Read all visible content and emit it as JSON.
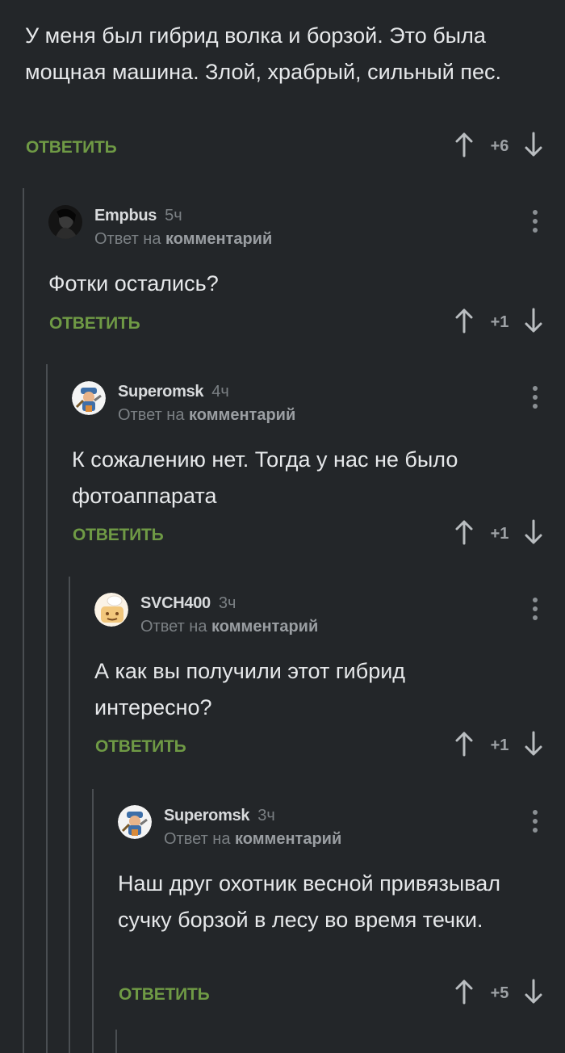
{
  "root": {
    "text": "У меня был гибрид волка и борзой. Это была мощная машина. Злой, храбрый, сильный пес.",
    "reply_label": "ОТВЕТИТЬ",
    "score": "+6"
  },
  "comments": [
    {
      "user": "Empbus",
      "time": "5ч",
      "reply_prefix": "Ответ на",
      "reply_target": "комментарий",
      "text": "Фотки остались?",
      "reply_label": "ОТВЕТИТЬ",
      "score": "+1",
      "avatar": "dark-portrait"
    },
    {
      "user": "Superomsk",
      "time": "4ч",
      "reply_prefix": "Ответ на",
      "reply_target": "комментарий",
      "text": "К сожалению нет. Тогда у нас не было фотоаппарата",
      "reply_label": "ОТВЕТИТЬ",
      "score": "+1",
      "avatar": "cartoon-miner"
    },
    {
      "user": "SVCH400",
      "time": "3ч",
      "reply_prefix": "Ответ на",
      "reply_target": "комментарий",
      "text": "А как вы получили этот гибрид интересно?",
      "reply_label": "ОТВЕТИТЬ",
      "score": "+1",
      "avatar": "cartoon-chef"
    },
    {
      "user": "Superomsk",
      "time": "3ч",
      "reply_prefix": "Ответ на",
      "reply_target": "комментарий",
      "text": "Наш друг охотник весной привязывал сучку борзой в лесу во время течки.",
      "reply_label": "ОТВЕТИТЬ",
      "score": "+5",
      "avatar": "cartoon-miner"
    }
  ],
  "colors": {
    "background": "#232629",
    "reply_green": "#6f9a45",
    "thread_line": "#4a4e52",
    "muted": "#7b8084"
  }
}
